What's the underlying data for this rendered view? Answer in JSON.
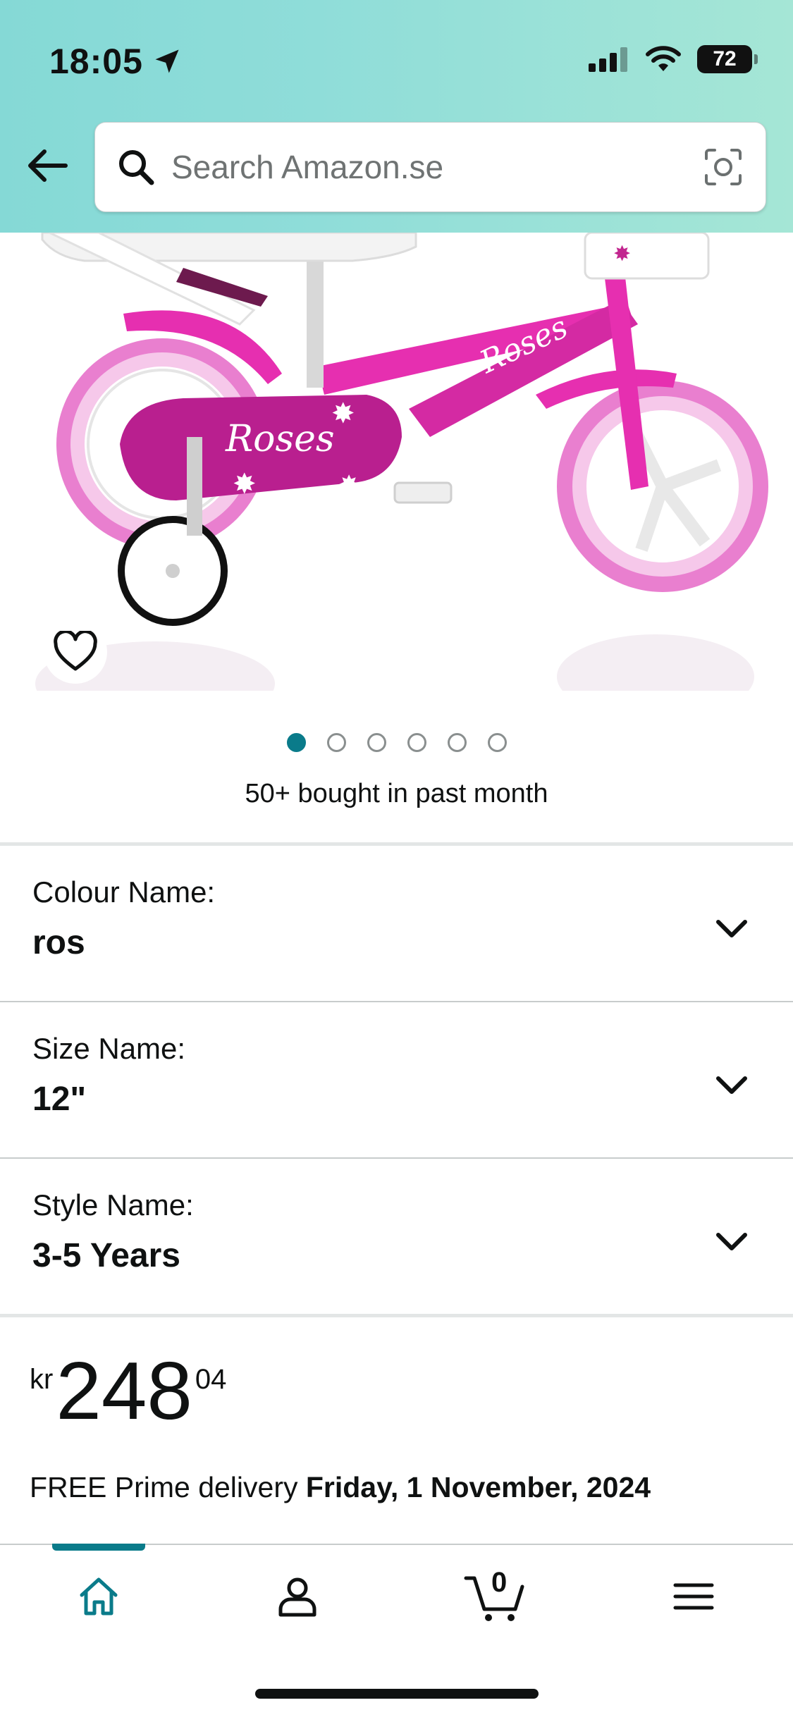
{
  "status_bar": {
    "time": "18:05",
    "battery": "72"
  },
  "search": {
    "placeholder": "Search Amazon.se"
  },
  "gallery": {
    "image_count": 6,
    "active_index": 0
  },
  "product_image": {
    "frame_text": "Roses",
    "down_tube_text": "Roses"
  },
  "social_proof": "50+ bought in past month",
  "variants": [
    {
      "label": "Colour Name:",
      "value": "ros"
    },
    {
      "label": "Size Name:",
      "value": "12\""
    },
    {
      "label": "Style Name:",
      "value": "3-5 Years"
    }
  ],
  "price": {
    "currency": "kr",
    "whole": "248",
    "fraction": "04"
  },
  "delivery": {
    "prefix": "FREE Prime delivery ",
    "date": "Friday, 1 November, 2024"
  },
  "bottom_nav": {
    "items": [
      "home-icon",
      "account-icon",
      "cart-icon",
      "menu-icon"
    ],
    "cart_count": "0",
    "active": "home"
  },
  "colors": {
    "accent": "#0a7b8a",
    "header_gradient_start": "#85d9d6",
    "header_gradient_end": "#a5e6d6",
    "bike_pink": "#e62fb0"
  }
}
